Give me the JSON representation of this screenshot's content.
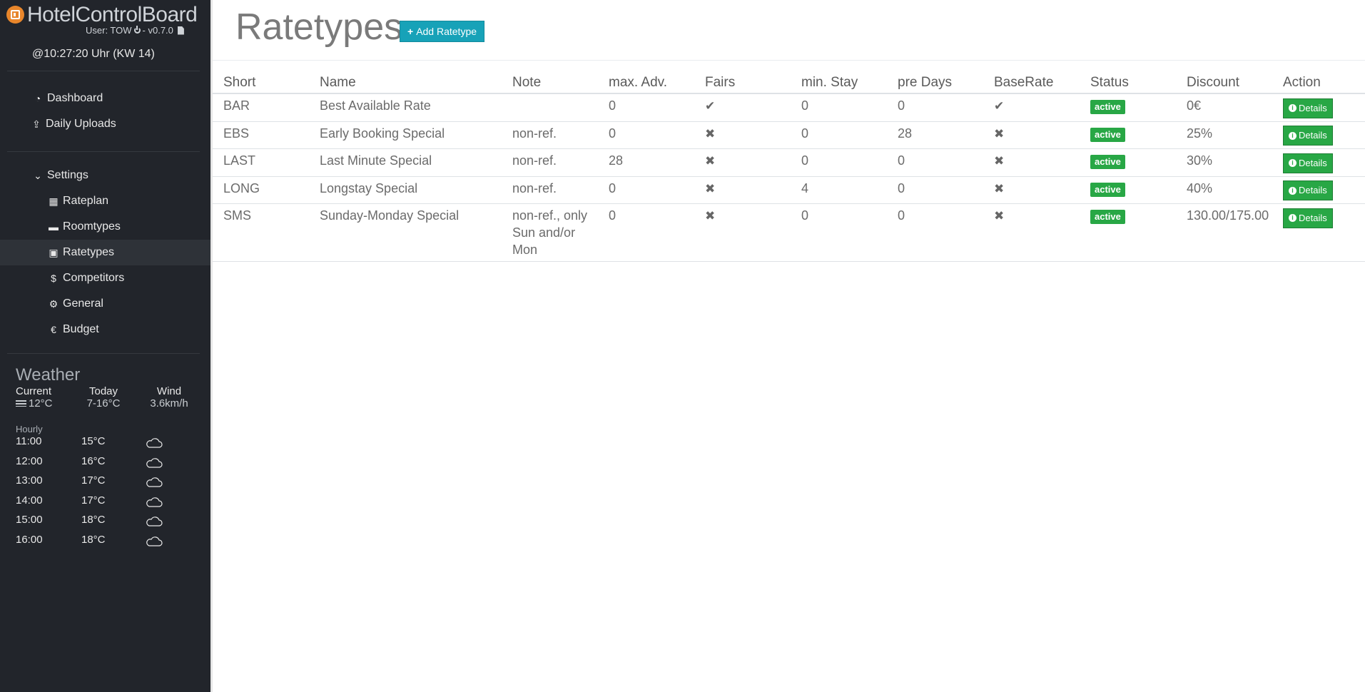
{
  "app": {
    "brand": "HotelControlBoard",
    "user_line": "User: TOW",
    "version": "- v0.7.0",
    "clock": "@10:27:20 Uhr (KW 14)"
  },
  "nav": {
    "dashboard": "Dashboard",
    "daily_uploads": "Daily Uploads",
    "settings": "Settings",
    "rateplan": "Rateplan",
    "roomtypes": "Roomtypes",
    "ratetypes": "Ratetypes",
    "competitors": "Competitors",
    "general": "General",
    "budget": "Budget"
  },
  "weather": {
    "title": "Weather",
    "current_label": "Current",
    "current_value": "12°C",
    "today_label": "Today",
    "today_value": "7-16°C",
    "wind_label": "Wind",
    "wind_value": "3.6km/h",
    "hourly_label": "Hourly",
    "hourly": [
      {
        "time": "11:00",
        "temp": "15°C",
        "icon": "cloud-icon"
      },
      {
        "time": "12:00",
        "temp": "16°C",
        "icon": "cloud-icon"
      },
      {
        "time": "13:00",
        "temp": "17°C",
        "icon": "cloud-icon"
      },
      {
        "time": "14:00",
        "temp": "17°C",
        "icon": "cloud-icon"
      },
      {
        "time": "15:00",
        "temp": "18°C",
        "icon": "cloud-icon"
      },
      {
        "time": "16:00",
        "temp": "18°C",
        "icon": "cloud-icon"
      }
    ]
  },
  "page": {
    "title": "Ratetypes",
    "add_button": "Add Ratetype"
  },
  "table": {
    "headers": [
      "Short",
      "Name",
      "Note",
      "max. Adv.",
      "Fairs",
      "min. Stay",
      "pre Days",
      "BaseRate",
      "Status",
      "Discount",
      "Action"
    ],
    "rows": [
      {
        "short": "BAR",
        "name": "Best Available Rate",
        "note": "",
        "max_adv": "0",
        "fairs": true,
        "min_stay": "0",
        "pre_days": "0",
        "base_rate": true,
        "status": "active",
        "discount": "0€",
        "action": "Details"
      },
      {
        "short": "EBS",
        "name": "Early Booking Special",
        "note": "non-ref.",
        "max_adv": "0",
        "fairs": false,
        "min_stay": "0",
        "pre_days": "28",
        "base_rate": false,
        "status": "active",
        "discount": "25%",
        "action": "Details"
      },
      {
        "short": "LAST",
        "name": "Last Minute Special",
        "note": "non-ref.",
        "max_adv": "28",
        "fairs": false,
        "min_stay": "0",
        "pre_days": "0",
        "base_rate": false,
        "status": "active",
        "discount": "30%",
        "action": "Details"
      },
      {
        "short": "LONG",
        "name": "Longstay Special",
        "note": "non-ref.",
        "max_adv": "0",
        "fairs": false,
        "min_stay": "4",
        "pre_days": "0",
        "base_rate": false,
        "status": "active",
        "discount": "40%",
        "action": "Details"
      },
      {
        "short": "SMS",
        "name": "Sunday-Monday Special",
        "note": "non-ref., only Sun and/or Mon",
        "max_adv": "0",
        "fairs": false,
        "min_stay": "0",
        "pre_days": "0",
        "base_rate": false,
        "status": "active",
        "discount": "130.00/175.00",
        "action": "Details"
      }
    ]
  },
  "colors": {
    "sidebar_bg": "#22252b",
    "accent_info": "#17a2b8",
    "success": "#28a745"
  }
}
